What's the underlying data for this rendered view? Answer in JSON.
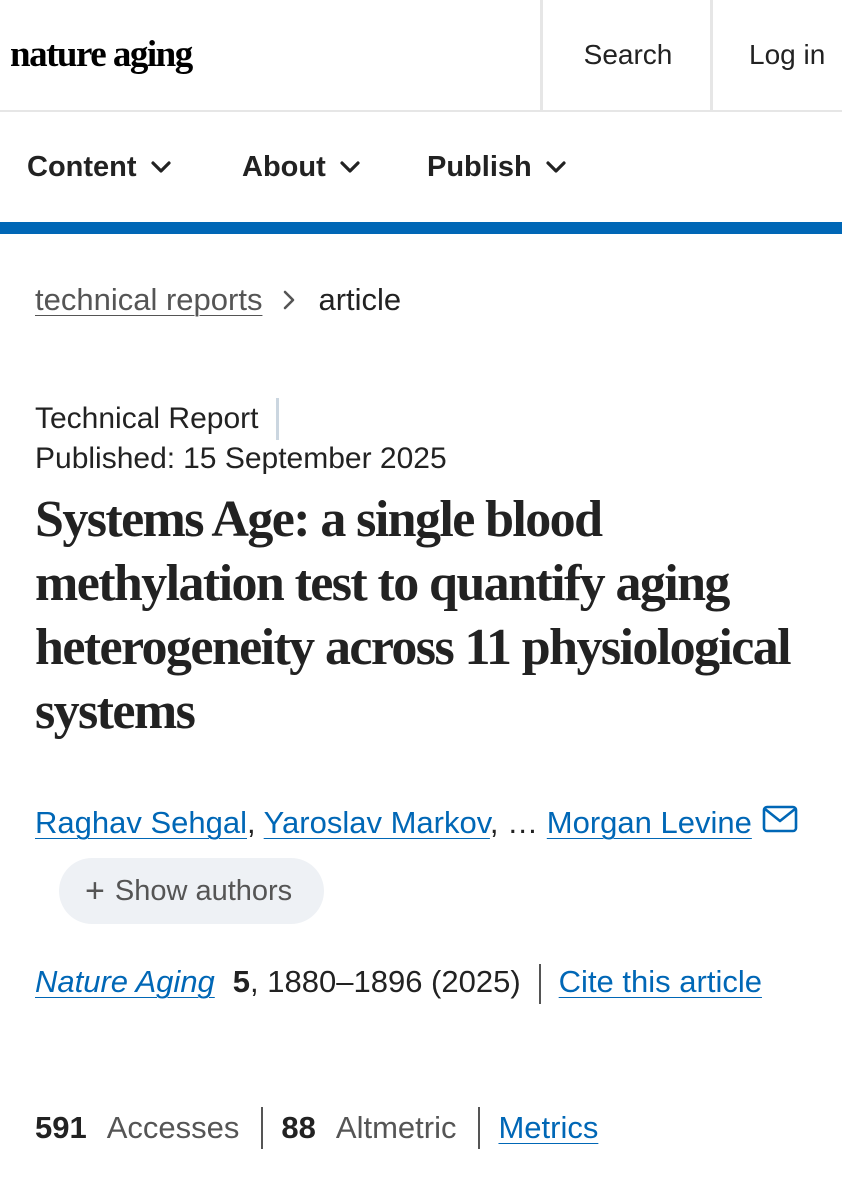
{
  "header": {
    "logo": "nature aging",
    "search_label": "Search",
    "login_label": "Log in"
  },
  "nav": {
    "items": [
      {
        "label": "Content"
      },
      {
        "label": "About"
      },
      {
        "label": "Publish"
      }
    ],
    "accent_color": "#0067b6"
  },
  "breadcrumb": {
    "parent": "technical reports",
    "current": "article"
  },
  "article": {
    "type": "Technical Report",
    "published_label": "Published:",
    "published_date": "15 September 2025",
    "title": "Systems Age: a single blood methylation test to quantify aging heterogeneity across 11 physiological systems",
    "authors": {
      "author1": "Raghav Sehgal",
      "author2": "Yaroslav Markov",
      "ellipsis": "…",
      "last_author": "Morgan Levine",
      "show_authors_label": "Show authors"
    },
    "citation": {
      "journal": "Nature Aging",
      "volume": "5",
      "pages_year": ", 1880–1896 (2025)",
      "cite_label": "Cite this article"
    },
    "metrics": {
      "accesses_count": "591",
      "accesses_label": "Accesses",
      "altmetric_count": "88",
      "altmetric_label": "Altmetric",
      "metrics_link": "Metrics"
    }
  },
  "colors": {
    "link": "#0067b6",
    "text": "#222222",
    "muted": "#555555",
    "pill_bg": "#eef1f5"
  },
  "icons": {
    "nav_dropdown": "chevron-down-icon",
    "breadcrumb_sep": "chevron-right-icon",
    "author_contact": "mail-icon",
    "show_authors": "plus-icon"
  }
}
